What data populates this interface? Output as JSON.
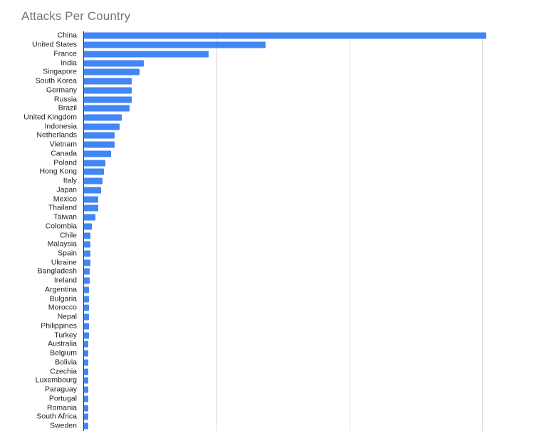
{
  "chart": {
    "title": "Attacks Per Country",
    "title_color": "#757575",
    "bar_color": "#4285f4",
    "gridline_color": "#dddddd",
    "axis_color": "#333333",
    "label_color": "#222222",
    "background": "#ffffff"
  },
  "chart_data": {
    "type": "bar",
    "orientation": "horizontal",
    "title": "Attacks Per Country",
    "xlabel": "",
    "ylabel": "",
    "grid": true,
    "legend": "none",
    "xlim": [
      0,
      15150
    ],
    "xticks": [
      0,
      5000,
      10000,
      15000
    ],
    "xtick_labels": [
      "",
      "",
      "",
      ""
    ],
    "categories": [
      "China",
      "United States",
      "France",
      "India",
      "Singapore",
      "South Korea",
      "Germany",
      "Russia",
      "Brazil",
      "United Kingdom",
      "Indonesia",
      "Netherlands",
      "Vietnam",
      "Canada",
      "Poland",
      "Hong Kong",
      "Italy",
      "Japan",
      "Mexico",
      "Thailand",
      "Taiwan",
      "Colombia",
      "Chile",
      "Malaysia",
      "Spain",
      "Ukraine",
      "Bangladesh",
      "Ireland",
      "Argentina",
      "Bulgaria",
      "Morocco",
      "Nepal",
      "Philippines",
      "Turkey",
      "Australia",
      "Belgium",
      "Bolivia",
      "Czechia",
      "Luxembourg",
      "Paraguay",
      "Portugal",
      "Romania",
      "South Africa",
      "Sweden"
    ],
    "values": [
      15150,
      6840,
      4690,
      2250,
      2090,
      1800,
      1800,
      1800,
      1720,
      1420,
      1340,
      1150,
      1150,
      1020,
      800,
      750,
      700,
      640,
      530,
      530,
      430,
      300,
      240,
      240,
      240,
      240,
      210,
      210,
      190,
      190,
      190,
      190,
      190,
      190,
      170,
      170,
      170,
      170,
      170,
      170,
      170,
      170,
      170,
      170
    ]
  }
}
